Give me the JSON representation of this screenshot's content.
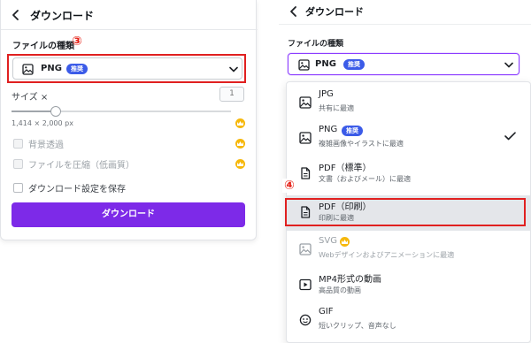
{
  "left": {
    "header": {
      "title": "ダウンロード"
    },
    "file_type_label": "ファイルの種類",
    "step_marker": "③",
    "select": {
      "value": "PNG",
      "badge": "推奨"
    },
    "size": {
      "label": "サイズ ×",
      "value": "1",
      "dimensions": "1,414 × 2,000 px",
      "slider_fraction": 0.2
    },
    "options": [
      {
        "label": "背景透過",
        "checked": false,
        "disabled": true,
        "premium": true
      },
      {
        "label": "ファイルを圧縮（低画質）",
        "checked": false,
        "disabled": true,
        "premium": true
      },
      {
        "label": "ダウンロード設定を保存",
        "checked": false,
        "disabled": false,
        "premium": false
      }
    ],
    "download_button": "ダウンロード"
  },
  "right": {
    "header": {
      "title": "ダウンロード"
    },
    "file_type_label": "ファイルの種類",
    "select": {
      "value": "PNG",
      "badge": "推奨"
    },
    "step_marker": "④",
    "dropdown": [
      {
        "title": "JPG",
        "subtitle": "共有に最適",
        "icon": "image-icon"
      },
      {
        "title": "PNG",
        "badge": "推奨",
        "subtitle": "複雑画像やイラストに最適",
        "icon": "image-icon",
        "selected": true
      },
      {
        "title": "PDF（標準）",
        "subtitle": "文書（およびメール）に最適",
        "icon": "document-icon"
      },
      {
        "title": "PDF（印刷）",
        "subtitle": "印刷に最適",
        "icon": "document-icon",
        "highlighted": true
      },
      {
        "title": "SVG",
        "subtitle": "Webデザインおよびアニメーションに最適",
        "icon": "image-icon",
        "premium": true,
        "disabled": true
      },
      {
        "title": "MP4形式の動画",
        "subtitle": "高品質の動画",
        "icon": "video-icon"
      },
      {
        "title": "GIF",
        "subtitle": "短いクリップ、音声なし",
        "icon": "gif-icon"
      }
    ]
  },
  "colors": {
    "accent": "#7d2ae8",
    "badge": "#3b5be8",
    "annotation": "#e02020",
    "premium": "#f6b80c"
  }
}
